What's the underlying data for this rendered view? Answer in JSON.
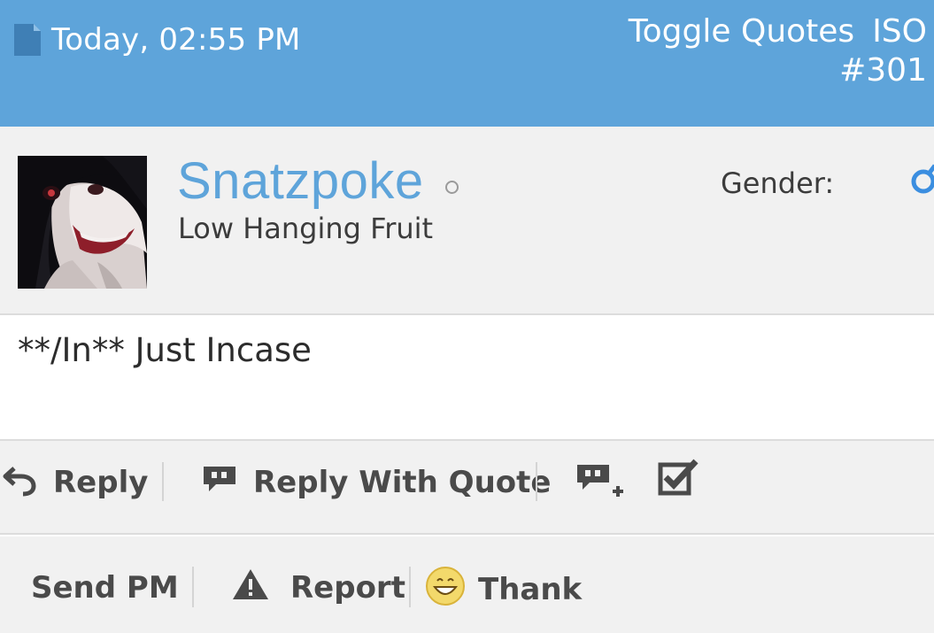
{
  "header": {
    "date": "Today, 02:55 PM",
    "toggle_quotes": "Toggle Quotes",
    "iso": "ISO",
    "post_number": "#301"
  },
  "user": {
    "username": "Snatzpoke",
    "usertitle": "Low Hanging Fruit",
    "gender_label": "Gender:",
    "status": "offline"
  },
  "post": {
    "text": "**/In** Just Incase"
  },
  "actions": {
    "reply": "Reply",
    "reply_with_quote": "Reply With Quote",
    "send_pm": "Send PM",
    "report": "Report",
    "thank": "Thank"
  },
  "colors": {
    "header_bg": "#5ea4da",
    "username": "#5ea4da",
    "panel_bg": "#f1f1f1",
    "action_text": "#4a4a4a"
  },
  "icons": {
    "date": "document-icon",
    "online_status": "status-dot-icon",
    "gender": "male-gender-icon",
    "reply": "reply-arrow-icon",
    "reply_with_quote": "quote-bubble-icon",
    "multi_quote": "multi-quote-plus-icon",
    "moderate": "checkbox-checked-icon",
    "report": "warning-triangle-icon",
    "thank": "smiley-icon"
  }
}
